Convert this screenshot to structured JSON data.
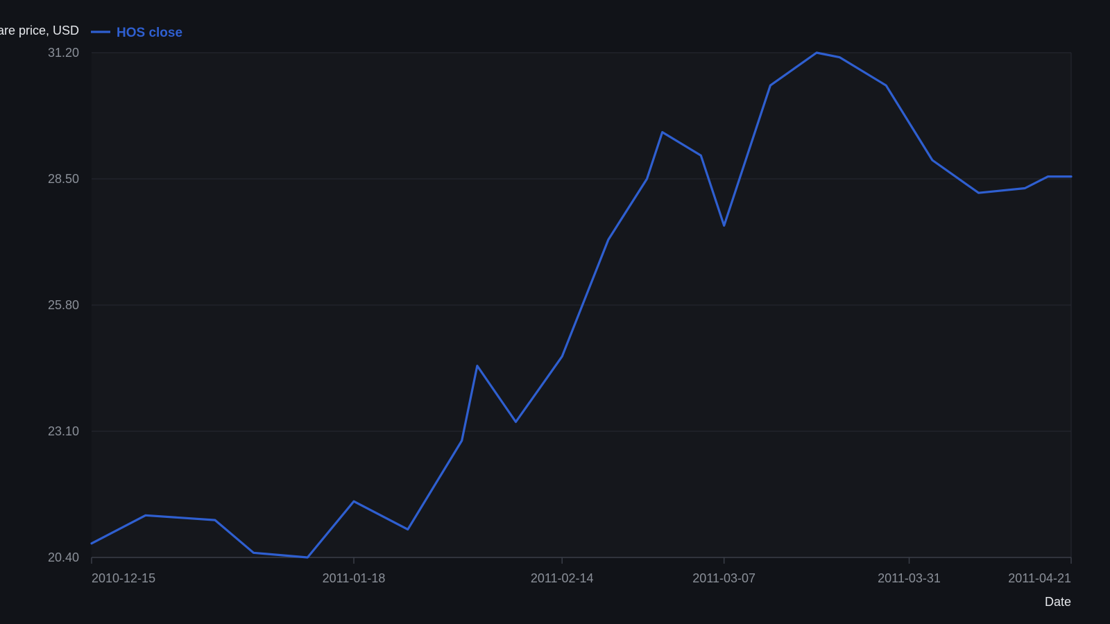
{
  "chart_data": {
    "type": "line",
    "title": "",
    "xlabel": "Date",
    "ylabel": "Share price, USD",
    "x_type": "date",
    "xlim": [
      "2010-12-15",
      "2011-04-21"
    ],
    "ylim": [
      20.4,
      31.2
    ],
    "y_ticks": [
      "20.40",
      "23.10",
      "25.80",
      "28.50",
      "31.20"
    ],
    "x_ticks": [
      "2010-12-15",
      "2011-01-18",
      "2011-02-14",
      "2011-03-07",
      "2011-03-31",
      "2011-04-21"
    ],
    "grid": {
      "horizontal": true,
      "vertical": false
    },
    "legend": {
      "position": "top-left",
      "entries": [
        "HOS close"
      ]
    },
    "colors": {
      "background": "#111318",
      "plot_background": "#15171c",
      "series": "#2f5fd0",
      "grid": "#262932",
      "axis": "#3a3e48"
    },
    "series": [
      {
        "name": "HOS close",
        "x": [
          "2010-12-15",
          "2010-12-22",
          "2010-12-31",
          "2011-01-05",
          "2011-01-12",
          "2011-01-18",
          "2011-01-25",
          "2011-02-01",
          "2011-02-03",
          "2011-02-08",
          "2011-02-11",
          "2011-02-14",
          "2011-02-20",
          "2011-02-25",
          "2011-02-27",
          "2011-03-04",
          "2011-03-07",
          "2011-03-13",
          "2011-03-19",
          "2011-03-22",
          "2011-03-28",
          "2011-04-03",
          "2011-04-09",
          "2011-04-15",
          "2011-04-18",
          "2011-04-21"
        ],
        "values": [
          20.7,
          21.3,
          21.2,
          20.5,
          20.4,
          21.6,
          21.0,
          22.9,
          24.5,
          23.3,
          24.0,
          24.7,
          27.2,
          28.5,
          29.5,
          29.0,
          27.5,
          30.5,
          31.2,
          31.1,
          30.5,
          28.9,
          28.2,
          28.3,
          28.55,
          28.55
        ]
      }
    ]
  }
}
